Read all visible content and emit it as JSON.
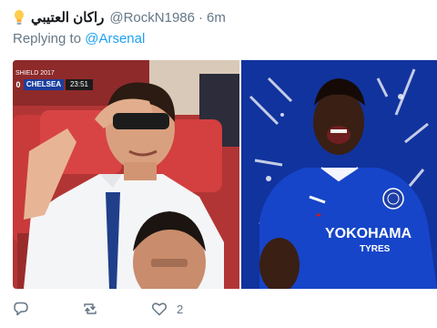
{
  "tweet": {
    "display_name": "راكان العتيبي",
    "handle": "@RockN1986",
    "separator": "·",
    "time": "6m",
    "reply_prefix": "Replying to",
    "reply_to": "@Arsenal"
  },
  "score_bug": {
    "competition": "SHIELD 2017",
    "score": "0",
    "team": "CHELSEA",
    "clock": "23:51"
  },
  "right_image": {
    "sponsor": "YOKOHAMA",
    "sponsor_sub": "TYRES"
  },
  "actions": {
    "like_count": "2"
  },
  "icons": [
    "lightbulb-icon",
    "reply-icon",
    "retweet-icon",
    "like-icon"
  ],
  "colors": {
    "link": "#1da1f2",
    "muted": "#657786",
    "chelsea_blue": "#1b3e9e"
  }
}
